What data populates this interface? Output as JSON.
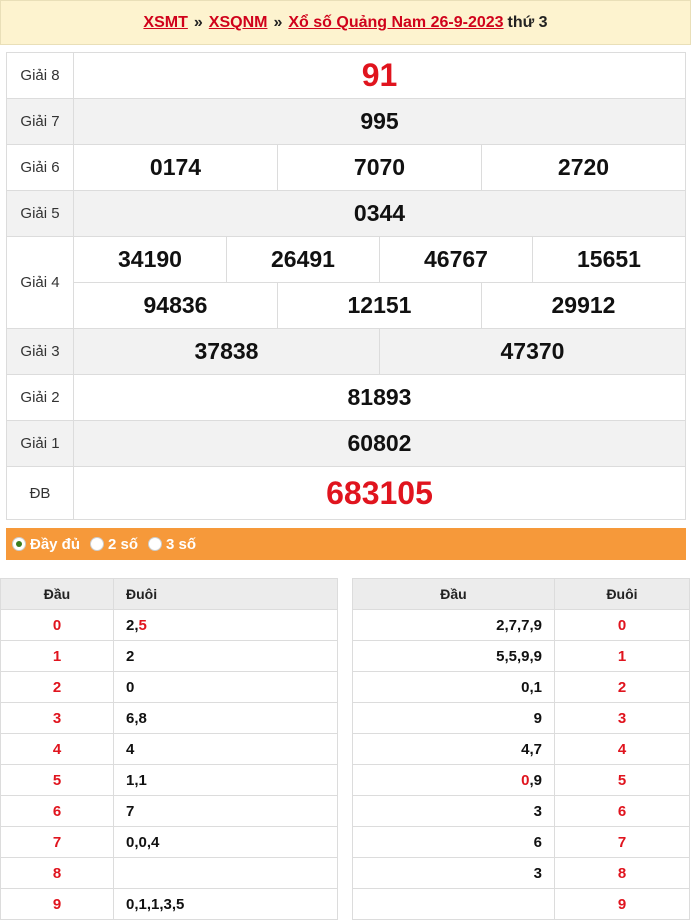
{
  "breadcrumb": {
    "link1": "XSMT",
    "sep": "»",
    "link2": "XSQNM",
    "link3": "Xổ số Quảng Nam 26-9-2023",
    "weekday": "thứ 3"
  },
  "prizes": {
    "g8": {
      "label": "Giải 8",
      "values": [
        "91"
      ]
    },
    "g7": {
      "label": "Giải 7",
      "values": [
        "995"
      ]
    },
    "g6": {
      "label": "Giải 6",
      "values": [
        "0174",
        "7070",
        "2720"
      ]
    },
    "g5": {
      "label": "Giải 5",
      "values": [
        "0344"
      ]
    },
    "g4": {
      "label": "Giải 4",
      "values": [
        "34190",
        "26491",
        "46767",
        "15651",
        "94836",
        "12151",
        "29912"
      ]
    },
    "g3": {
      "label": "Giải 3",
      "values": [
        "37838",
        "47370"
      ]
    },
    "g2": {
      "label": "Giải 2",
      "values": [
        "81893"
      ]
    },
    "g1": {
      "label": "Giải 1",
      "values": [
        "60802"
      ]
    },
    "db": {
      "label": "ĐB",
      "values": [
        "683105"
      ]
    }
  },
  "options": {
    "full": "Đầy đủ",
    "two": "2 số",
    "three": "3 số",
    "selected": "full"
  },
  "loto": {
    "headers": {
      "dau": "Đầu",
      "duoi": "Đuôi"
    },
    "left": [
      {
        "head": "0",
        "tail": [
          {
            "t": "2,",
            "red": false
          },
          {
            "t": "5",
            "red": true
          }
        ]
      },
      {
        "head": "1",
        "tail": [
          {
            "t": "2",
            "red": false
          }
        ]
      },
      {
        "head": "2",
        "tail": [
          {
            "t": "0",
            "red": false
          }
        ]
      },
      {
        "head": "3",
        "tail": [
          {
            "t": "6,8",
            "red": false
          }
        ]
      },
      {
        "head": "4",
        "tail": [
          {
            "t": "4",
            "red": false
          }
        ]
      },
      {
        "head": "5",
        "tail": [
          {
            "t": "1,1",
            "red": false
          }
        ]
      },
      {
        "head": "6",
        "tail": [
          {
            "t": "7",
            "red": false
          }
        ]
      },
      {
        "head": "7",
        "tail": [
          {
            "t": "0,0,4",
            "red": false
          }
        ]
      },
      {
        "head": "8",
        "tail": []
      },
      {
        "head": "9",
        "tail": [
          {
            "t": "0,1,1,3,5",
            "red": false
          }
        ]
      }
    ],
    "right": [
      {
        "tail": "0",
        "head": [
          {
            "t": "2,7,7,9",
            "red": false
          }
        ]
      },
      {
        "tail": "1",
        "head": [
          {
            "t": "5,5,9,9",
            "red": false
          }
        ]
      },
      {
        "tail": "2",
        "head": [
          {
            "t": "0,1",
            "red": false
          }
        ]
      },
      {
        "tail": "3",
        "head": [
          {
            "t": "9",
            "red": false
          }
        ]
      },
      {
        "tail": "4",
        "head": [
          {
            "t": "4,7",
            "red": false
          }
        ]
      },
      {
        "tail": "5",
        "head": [
          {
            "t": "0",
            "red": true
          },
          {
            "t": ",9",
            "red": false
          }
        ]
      },
      {
        "tail": "6",
        "head": [
          {
            "t": "3",
            "red": false
          }
        ]
      },
      {
        "tail": "7",
        "head": [
          {
            "t": "6",
            "red": false
          }
        ]
      },
      {
        "tail": "8",
        "head": [
          {
            "t": "3",
            "red": false
          }
        ]
      },
      {
        "tail": "9",
        "head": []
      }
    ]
  },
  "colors": {
    "accent_red": "#e0141e",
    "orange_bar": "#f6993a",
    "title_bg": "#fdf3cf"
  }
}
